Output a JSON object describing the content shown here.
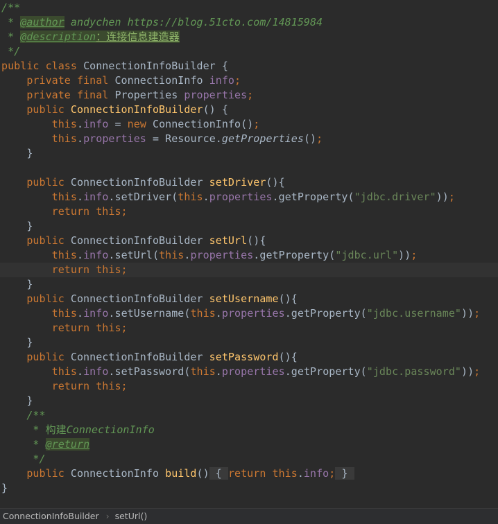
{
  "editor": {
    "current_line": 18,
    "lines": [
      [
        [
          "/**",
          "c"
        ]
      ],
      [
        [
          " * ",
          "c"
        ],
        [
          "@author",
          "t"
        ],
        [
          " andychen https://blog.51cto.com/14815984",
          "c"
        ]
      ],
      [
        [
          " * ",
          "c"
        ],
        [
          "@description",
          "t"
        ],
        [
          "：连接信息建造器",
          "tc"
        ]
      ],
      [
        [
          " */",
          "c"
        ]
      ],
      [
        [
          "public class ",
          "k"
        ],
        [
          "ConnectionInfoBuilder {",
          "p"
        ]
      ],
      [
        [
          "    private final ",
          "k"
        ],
        [
          "ConnectionInfo ",
          "p"
        ],
        [
          "info",
          "f"
        ],
        [
          ";",
          "k"
        ]
      ],
      [
        [
          "    private final ",
          "k"
        ],
        [
          "Properties ",
          "p"
        ],
        [
          "properties",
          "f"
        ],
        [
          ";",
          "k"
        ]
      ],
      [
        [
          "    public ",
          "k"
        ],
        [
          "ConnectionInfoBuilder",
          "m"
        ],
        [
          "() {",
          "p"
        ]
      ],
      [
        [
          "        this",
          "k"
        ],
        [
          ".",
          "p"
        ],
        [
          "info",
          "f"
        ],
        [
          " = ",
          "p"
        ],
        [
          "new ",
          "k"
        ],
        [
          "ConnectionInfo()",
          "p"
        ],
        [
          ";",
          "k"
        ]
      ],
      [
        [
          "        this",
          "k"
        ],
        [
          ".",
          "p"
        ],
        [
          "properties",
          "f"
        ],
        [
          " = Resource.",
          "p"
        ],
        [
          "getProperties",
          "i"
        ],
        [
          "()",
          "p"
        ],
        [
          ";",
          "k"
        ]
      ],
      [
        [
          "    }",
          "p"
        ]
      ],
      [
        [
          "",
          "p"
        ]
      ],
      [
        [
          "    public ",
          "k"
        ],
        [
          "ConnectionInfoBuilder ",
          "p"
        ],
        [
          "setDriver",
          "m"
        ],
        [
          "(){",
          "p"
        ]
      ],
      [
        [
          "        this",
          "k"
        ],
        [
          ".",
          "p"
        ],
        [
          "info",
          "f"
        ],
        [
          ".setDriver(",
          "p"
        ],
        [
          "this",
          "k"
        ],
        [
          ".",
          "p"
        ],
        [
          "properties",
          "f"
        ],
        [
          ".getProperty(",
          "p"
        ],
        [
          "\"jdbc.driver\"",
          "s"
        ],
        [
          "))",
          "p"
        ],
        [
          ";",
          "k"
        ]
      ],
      [
        [
          "        return this",
          "k"
        ],
        [
          ";",
          "k"
        ]
      ],
      [
        [
          "    }",
          "p"
        ]
      ],
      [
        [
          "    public ",
          "k"
        ],
        [
          "ConnectionInfoBuilder ",
          "p"
        ],
        [
          "setUrl",
          "m"
        ],
        [
          "(){",
          "p"
        ]
      ],
      [
        [
          "        this",
          "k"
        ],
        [
          ".",
          "p"
        ],
        [
          "info",
          "f"
        ],
        [
          ".setUrl(",
          "p"
        ],
        [
          "this",
          "k"
        ],
        [
          ".",
          "p"
        ],
        [
          "properties",
          "f"
        ],
        [
          ".getProperty(",
          "p"
        ],
        [
          "\"jdbc.url\"",
          "s"
        ],
        [
          "))",
          "p"
        ],
        [
          ";",
          "k"
        ]
      ],
      [
        [
          "        return this",
          "k"
        ],
        [
          ";",
          "k"
        ]
      ],
      [
        [
          "    }",
          "p"
        ]
      ],
      [
        [
          "    public ",
          "k"
        ],
        [
          "ConnectionInfoBuilder ",
          "p"
        ],
        [
          "setUsername",
          "m"
        ],
        [
          "(){",
          "p"
        ]
      ],
      [
        [
          "        this",
          "k"
        ],
        [
          ".",
          "p"
        ],
        [
          "info",
          "f"
        ],
        [
          ".setUsername(",
          "p"
        ],
        [
          "this",
          "k"
        ],
        [
          ".",
          "p"
        ],
        [
          "properties",
          "f"
        ],
        [
          ".getProperty(",
          "p"
        ],
        [
          "\"jdbc.username\"",
          "s"
        ],
        [
          "))",
          "p"
        ],
        [
          ";",
          "k"
        ]
      ],
      [
        [
          "        return this",
          "k"
        ],
        [
          ";",
          "k"
        ]
      ],
      [
        [
          "    }",
          "p"
        ]
      ],
      [
        [
          "    public ",
          "k"
        ],
        [
          "ConnectionInfoBuilder ",
          "p"
        ],
        [
          "setPassword",
          "m"
        ],
        [
          "(){",
          "p"
        ]
      ],
      [
        [
          "        this",
          "k"
        ],
        [
          ".",
          "p"
        ],
        [
          "info",
          "f"
        ],
        [
          ".setPassword(",
          "p"
        ],
        [
          "this",
          "k"
        ],
        [
          ".",
          "p"
        ],
        [
          "properties",
          "f"
        ],
        [
          ".getProperty(",
          "p"
        ],
        [
          "\"jdbc.password\"",
          "s"
        ],
        [
          "))",
          "p"
        ],
        [
          ";",
          "k"
        ]
      ],
      [
        [
          "        return this",
          "k"
        ],
        [
          ";",
          "k"
        ]
      ],
      [
        [
          "    }",
          "p"
        ]
      ],
      [
        [
          "    /**",
          "c"
        ]
      ],
      [
        [
          "     * ",
          "c"
        ],
        [
          "构建",
          "cc"
        ],
        [
          "ConnectionInfo",
          "c"
        ]
      ],
      [
        [
          "     * ",
          "c"
        ],
        [
          "@return",
          "t"
        ]
      ],
      [
        [
          "     */",
          "c"
        ]
      ],
      [
        [
          "    public ",
          "k"
        ],
        [
          "ConnectionInfo ",
          "p"
        ],
        [
          "build",
          "m"
        ],
        [
          "()",
          "p"
        ],
        [
          " { ",
          "b"
        ],
        [
          "return this",
          "k"
        ],
        [
          ".",
          "p"
        ],
        [
          "info",
          "f"
        ],
        [
          ";",
          "k"
        ],
        [
          " } ",
          "b"
        ]
      ],
      [
        [
          "}",
          "p"
        ]
      ]
    ]
  },
  "breadcrumb": {
    "items": [
      "ConnectionInfoBuilder",
      "setUrl()"
    ],
    "separator": "›"
  }
}
